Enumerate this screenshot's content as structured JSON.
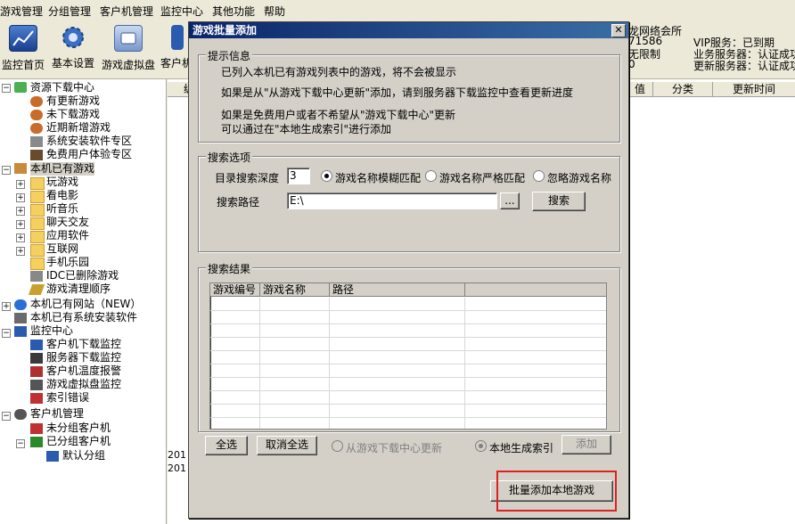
{
  "menubar": [
    "游戏管理",
    "分组管理",
    "客户机管理",
    "监控中心",
    "其他功能",
    "帮助"
  ],
  "toolbar": [
    {
      "label": "监控首页",
      "icon": "monitor-chart-icon"
    },
    {
      "label": "基本设置",
      "icon": "gear-icon"
    },
    {
      "label": "游戏虚拟盘",
      "icon": "virtual-disk-icon"
    },
    {
      "label": "客户机",
      "icon": "client-icon"
    }
  ],
  "status": {
    "shop_name": "龙网络会所",
    "id_fragment": "71586",
    "limit": "无限制",
    "zero": "0",
    "vip": "VIP服务：已到期",
    "biz_server": "业务服务器：认证成功",
    "update_server": "更新服务器：认证成功"
  },
  "tree": {
    "resource_center": "资源下载中心",
    "updated_games": "有更新游戏",
    "undownloaded": "未下载游戏",
    "recent_added": "近期新增游戏",
    "system_software": "系统安装软件专区",
    "free_trial": "免费用户体验专区",
    "local_games": "本机已有游戏",
    "play_games": "玩游戏",
    "movies": "看电影",
    "music": "听音乐",
    "chat": "聊天交友",
    "apps": "应用软件",
    "internet": "互联网",
    "mobile": "手机乐园",
    "idc_deleted": "IDC已删除游戏",
    "cleanup_order": "游戏清理顺序",
    "local_websites": "本机已有网站（NEW）",
    "local_system_software": "本机已有系统安装软件",
    "monitor_center": "监控中心",
    "client_download": "客户机下载监控",
    "server_download": "服务器下载监控",
    "client_temp": "客户机温度报警",
    "virtual_disk_monitor": "游戏虚拟盘监控",
    "index_error": "索引错误",
    "client_mgmt": "客户机管理",
    "ungrouped": "未分组客户机",
    "grouped": "已分组客户机",
    "default_group": "默认分组"
  },
  "rightpanel": {
    "headers": [
      "值",
      "分类",
      "更新时间"
    ],
    "partial_header": "编",
    "rows": [
      "201",
      "201"
    ]
  },
  "dialog": {
    "title": "游戏批量添加",
    "close": "✕",
    "notice": {
      "title": "提示信息",
      "line1": "已列入本机已有游戏列表中的游戏，将不会被显示",
      "line2": "如果是从\"从游戏下载中心更新\"添加，请到服务器下载监控中查看更新进度",
      "line3": "如果是免费用户或者不希望从\"游戏下载中心\"更新",
      "line4": "可以通过在\"本地生成索引\"进行添加"
    },
    "search": {
      "title": "搜索选项",
      "depth_label": "目录搜索深度",
      "depth_value": "3",
      "radio_fuzzy": "游戏名称模糊匹配",
      "radio_strict": "游戏名称严格匹配",
      "radio_ignore": "忽略游戏名称",
      "path_label": "搜索路径",
      "path_value": "E:\\",
      "browse": "...",
      "search_button": "搜索"
    },
    "results": {
      "title": "搜索结果",
      "columns": [
        "游戏编号",
        "游戏名称",
        "路径"
      ]
    },
    "select_all": "全选",
    "deselect_all": "取消全选",
    "radio_download_center": "从游戏下载中心更新",
    "radio_local_index": "本地生成索引",
    "add_button": "添加",
    "batch_add_button": "批量添加本地游戏"
  },
  "colors": {
    "title_bar": "#0a246a",
    "highlight_box": "#e02020"
  }
}
